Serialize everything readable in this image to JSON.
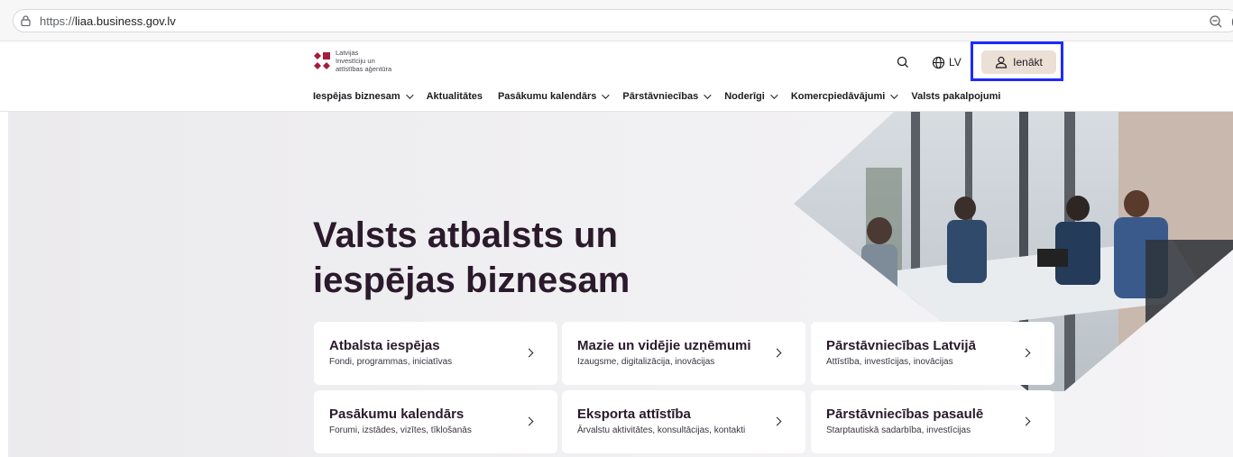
{
  "browser": {
    "url_scheme": "https://",
    "url_host": "liaa.business.gov.lv",
    "lock_icon": "lock-icon",
    "zoom_icon": "zoom-out-icon"
  },
  "header": {
    "logo_lines": [
      "Latvijas",
      "Investīciju un",
      "attīstības aģentūra"
    ],
    "logo_color": "#a51d3b",
    "search_icon": "search-icon",
    "language": "LV",
    "login_label": "Ienākt",
    "highlight_color": "#1a2bff"
  },
  "nav": {
    "items": [
      {
        "label": "Iespējas biznesam",
        "dropdown": true
      },
      {
        "label": "Aktualitātes",
        "dropdown": false
      },
      {
        "label": "Pasākumu kalendārs",
        "dropdown": true
      },
      {
        "label": "Pārstāvniecības",
        "dropdown": true
      },
      {
        "label": "Noderīgi",
        "dropdown": true
      },
      {
        "label": "Komercpiedāvājumi",
        "dropdown": true
      },
      {
        "label": "Valsts pakalpojumi",
        "dropdown": false
      }
    ]
  },
  "hero": {
    "headline_line1": "Valsts atbalsts un",
    "headline_line2": "iespējas biznesam",
    "cards": [
      {
        "title": "Atbalsta iespējas",
        "subtitle": "Fondi, programmas, iniciatīvas"
      },
      {
        "title": "Mazie un vidējie uzņēmumi",
        "subtitle": "Izaugsme, digitalizācija, inovācijas"
      },
      {
        "title": "Pārstāvniecības Latvijā",
        "subtitle": "Attīstība, investīcijas, inovācijas"
      },
      {
        "title": "Pasākumu kalendārs",
        "subtitle": "Forumi, izstādes, vizītes, tīklošanās"
      },
      {
        "title": "Eksporta attīstība",
        "subtitle": "Ārvalstu aktivitātes, konsultācijas, kontakti"
      },
      {
        "title": "Pārstāvniecības pasaulē",
        "subtitle": "Starptautiskā sadarbība, investīcijas"
      }
    ]
  }
}
